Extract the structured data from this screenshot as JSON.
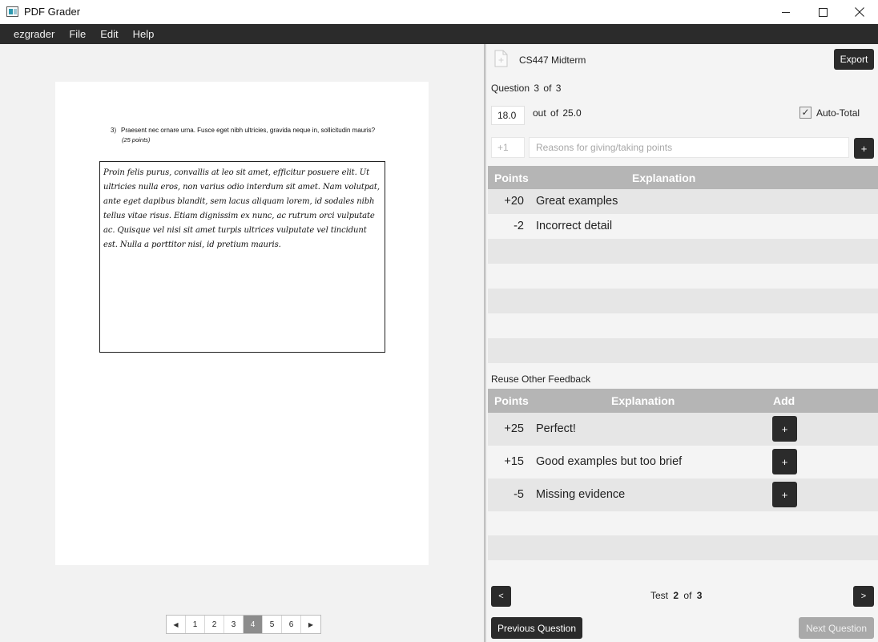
{
  "window": {
    "title": "PDF Grader",
    "minimize_icon": "minimize-icon",
    "maximize_icon": "maximize-icon",
    "close_icon": "close-icon"
  },
  "menu": [
    "ezgrader",
    "File",
    "Edit",
    "Help"
  ],
  "document": {
    "question_number": "3)",
    "question_text": "Praesent nec ornare urna. Fusce eget nibh ultricies, gravida neque in, sollicitudin mauris?",
    "question_points": "(25 points)",
    "answer_text": "Proin felis purus, convallis at leo sit amet, efficitur posuere elit. Ut ultricies nulla eros, non varius odio interdum sit amet. Nam volutpat, ante eget dapibus blandit, sem lacus aliquam lorem, id sodales nibh tellus vitae risus. Etiam dignissim ex nunc, ac rutrum orci vulputate ac. Quisque vel nisi sit amet turpis ultrices vulputate vel tincidunt est. Nulla a porttitor nisi, id pretium mauris.",
    "pages": [
      "1",
      "2",
      "3",
      "4",
      "5",
      "6"
    ],
    "current_page": "4",
    "prev_page_glyph": "◀",
    "next_page_glyph": "▶"
  },
  "panel": {
    "exam_title": "CS447 Midterm",
    "export_label": "Export",
    "question_label": "Question",
    "question_current": "3",
    "question_of": "of",
    "question_total": "3",
    "score_value": "18.0",
    "out_of_label": "out of",
    "out_of_value": "25.0",
    "auto_total_label": "Auto-Total",
    "auto_total_checked": true,
    "points_placeholder": "+1",
    "reason_placeholder": "Reasons for giving/taking points",
    "add_label": "+",
    "feedback_headers": {
      "points": "Points",
      "explanation": "Explanation"
    },
    "feedback": [
      {
        "points": "+20",
        "explanation": "Great examples"
      },
      {
        "points": "-2",
        "explanation": "Incorrect detail"
      }
    ],
    "reuse_label": "Reuse Other Feedback",
    "reuse_headers": {
      "points": "Points",
      "explanation": "Explanation",
      "add": "Add"
    },
    "reuse": [
      {
        "points": "+25",
        "explanation": "Perfect!"
      },
      {
        "points": "+15",
        "explanation": "Good examples but too brief"
      },
      {
        "points": "-5",
        "explanation": "Missing evidence"
      }
    ],
    "prev_test_label": "<",
    "next_test_label": ">",
    "test_label": "Test",
    "test_current": "2",
    "test_of": "of",
    "test_total": "3",
    "prev_question_label": "Previous Question",
    "next_question_label": "Next Question"
  }
}
